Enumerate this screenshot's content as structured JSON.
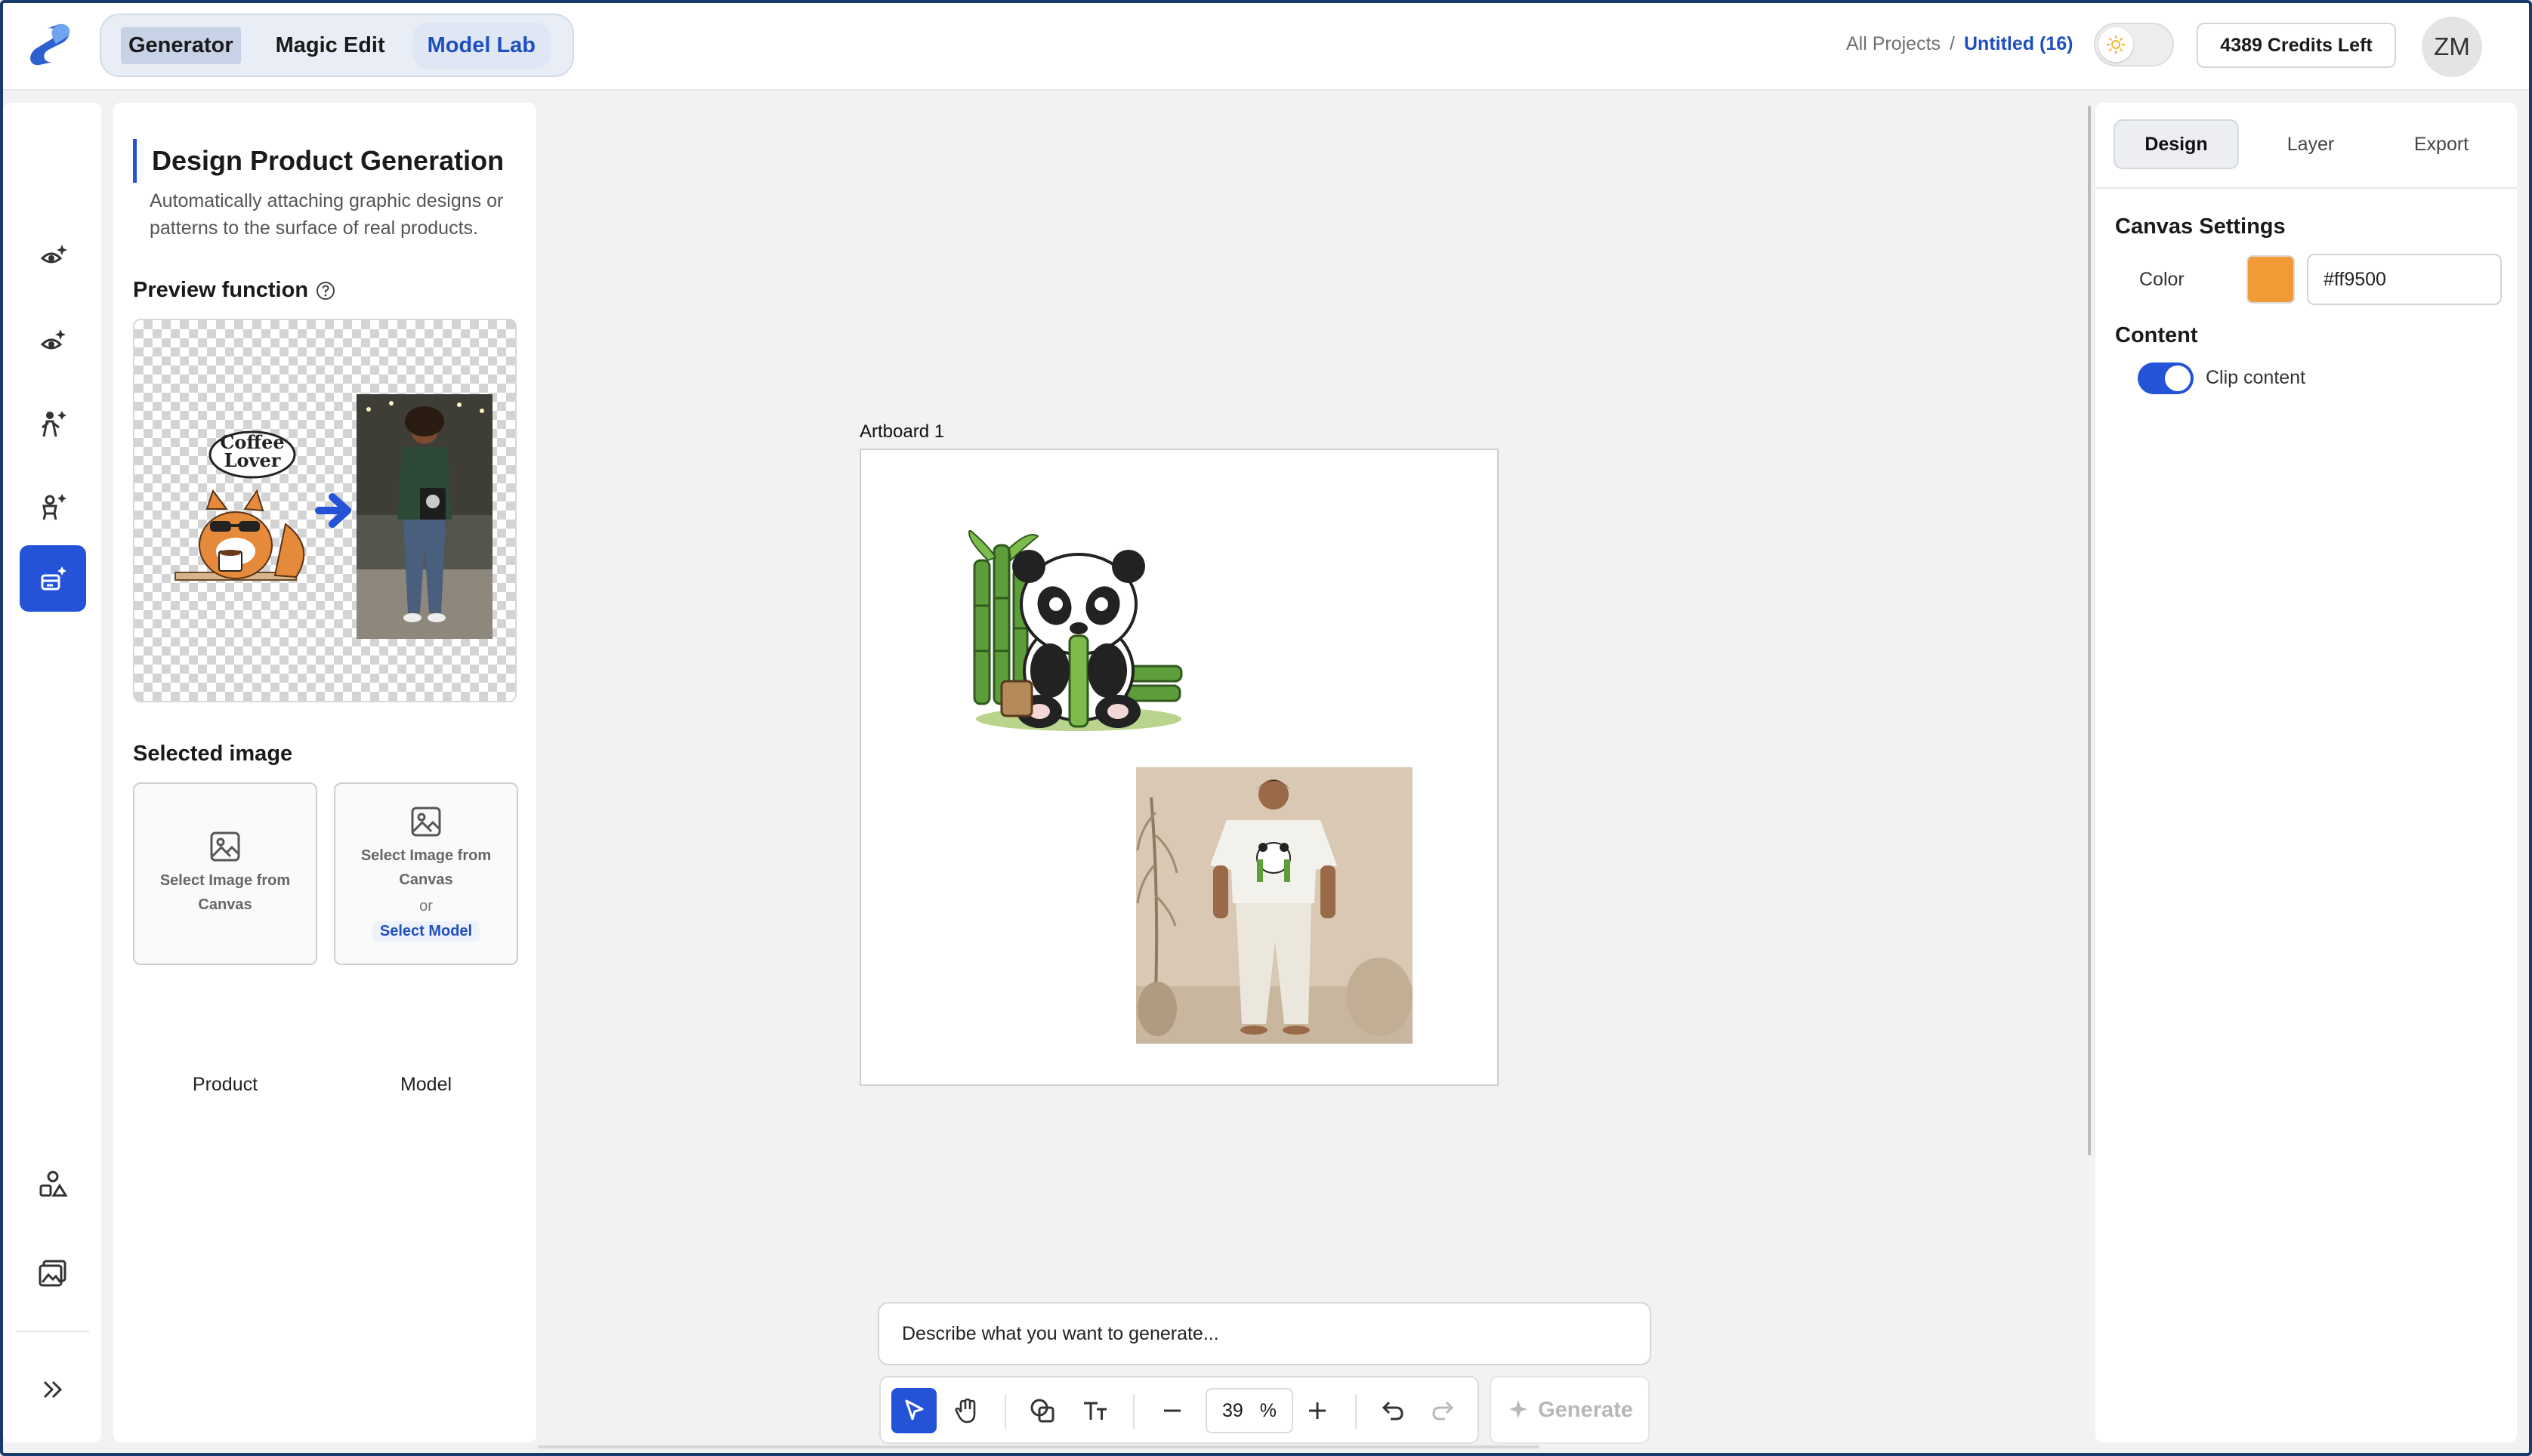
{
  "header": {
    "modes": [
      "Generator",
      "Magic Edit",
      "Model Lab"
    ],
    "breadcrumb_root": "All Projects",
    "breadcrumb_sep": "/",
    "breadcrumb_current": "Untitled (16)",
    "credits": "4389 Credits Left",
    "avatar_initials": "ZM"
  },
  "rail": {
    "tools": [
      "eye-sparkle-icon",
      "eye-sparkle-alt-icon",
      "person-sparkle-icon",
      "model-sparkle-icon",
      "pen-sparkle-icon",
      "product-design-icon"
    ],
    "bottom": [
      "shapes-icon",
      "gallery-icon",
      "expand-icon"
    ]
  },
  "panel": {
    "title": "Design Product Generation",
    "description": "Automatically attaching graphic designs or patterns to the surface of real products.",
    "preview_label": "Preview function",
    "preview_bubble_text": "Coffee Lover",
    "selected_label": "Selected image",
    "product_slot_text": "Select Image from Canvas",
    "model_slot_text": "Select Image from Canvas",
    "model_slot_or": "or",
    "model_slot_link": "Select Model",
    "product_caption": "Product",
    "model_caption": "Model"
  },
  "canvas": {
    "artboard_label": "Artboard 1",
    "prompt_placeholder": "Describe what you want to generate...",
    "zoom_value": "39",
    "zoom_unit": "%",
    "generate_label": "Generate"
  },
  "right": {
    "tabs": [
      "Design",
      "Layer",
      "Export"
    ],
    "canvas_settings_title": "Canvas Settings",
    "color_label": "Color",
    "color_value": "#ff9500",
    "swatch_display": "#f29a36",
    "content_title": "Content",
    "clip_label": "Clip content"
  },
  "colors": {
    "accent": "#2453d8",
    "link": "#1e4fbf",
    "frame": "#1a3a6b"
  }
}
